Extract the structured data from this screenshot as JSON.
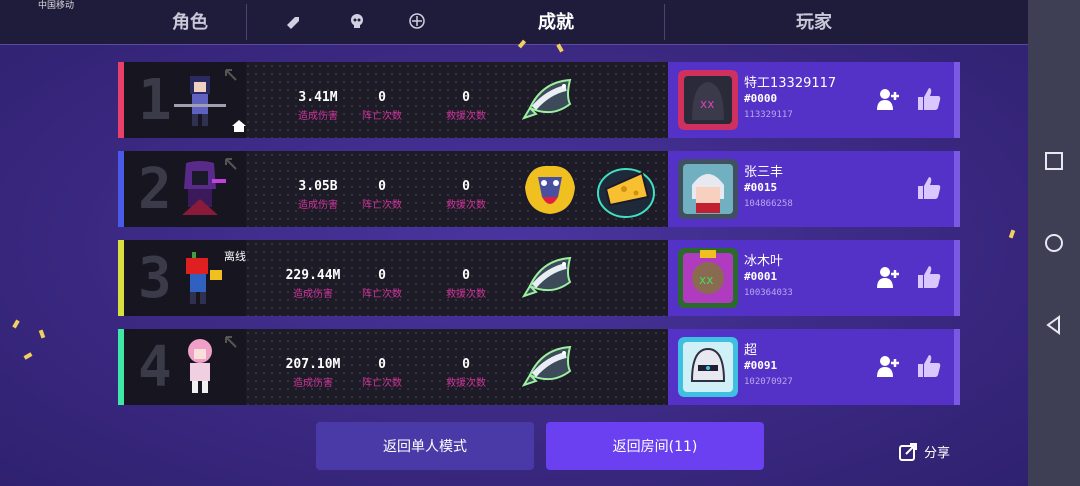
{
  "status_bar": {
    "carrier": "中国移动"
  },
  "tabs": [
    {
      "label": "角色"
    },
    {
      "label": "成就"
    },
    {
      "label": "玩家"
    }
  ],
  "rows": [
    {
      "rank": "1",
      "accent": "#e8406a",
      "damage": "3.41M",
      "deaths": "0",
      "rescues": "0",
      "player": {
        "name": "特工13329117",
        "tag": "#0000",
        "id": "113329117"
      },
      "has_add": true,
      "offline": ""
    },
    {
      "rank": "2",
      "accent": "#4a5ae8",
      "damage": "3.05B",
      "deaths": "0",
      "rescues": "0",
      "player": {
        "name": "张三丰",
        "tag": "#0015",
        "id": "104866258"
      },
      "has_add": false,
      "offline": ""
    },
    {
      "rank": "3",
      "accent": "#d8e040",
      "damage": "229.44M",
      "deaths": "0",
      "rescues": "0",
      "player": {
        "name": "冰木叶",
        "tag": "#0001",
        "id": "100364033"
      },
      "has_add": true,
      "offline": "离线"
    },
    {
      "rank": "4",
      "accent": "#40e8a8",
      "damage": "207.10M",
      "deaths": "0",
      "rescues": "0",
      "player": {
        "name": "超",
        "tag": "#0091",
        "id": "102070927"
      },
      "has_add": true,
      "offline": ""
    }
  ],
  "labels": {
    "damage": "造成伤害",
    "deaths": "阵亡次数",
    "rescues": "救援次数"
  },
  "buttons": {
    "single": "返回单人模式",
    "room": "返回房间(11)",
    "share": "分享"
  }
}
